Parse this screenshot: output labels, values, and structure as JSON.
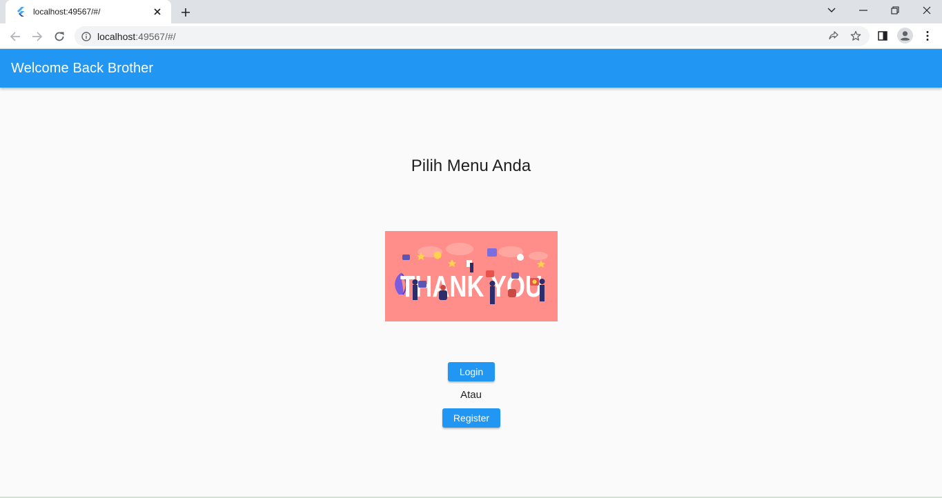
{
  "browser": {
    "tab_title": "localhost:49567/#/",
    "url_host": "localhost",
    "url_path": ":49567/#/",
    "icons": [
      "flutter-favicon",
      "close-icon",
      "plus-icon",
      "chevron-down-icon",
      "minimize-icon",
      "restore-icon",
      "close-window-icon",
      "back-arrow-icon",
      "forward-arrow-icon",
      "reload-icon",
      "info-icon",
      "share-icon",
      "star-icon",
      "side-panel-icon",
      "profile-icon",
      "kebab-menu-icon"
    ]
  },
  "app": {
    "title": "Welcome Back Brother",
    "accent_color": "#2196f3"
  },
  "main": {
    "heading": "Pilih Menu Anda",
    "banner_text": "THANK YOU",
    "login_label": "Login",
    "separator_label": "Atau",
    "register_label": "Register"
  }
}
